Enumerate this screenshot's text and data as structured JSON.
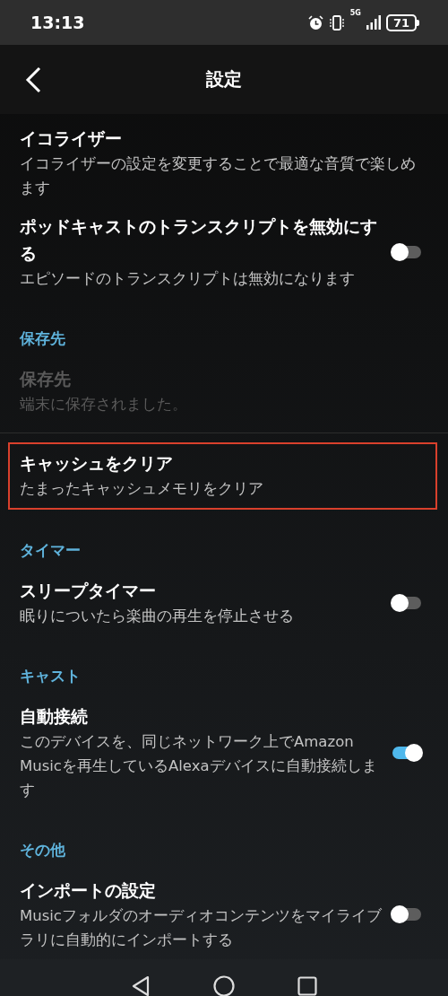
{
  "status_bar": {
    "time": "13:13",
    "network": "5G",
    "battery": "71"
  },
  "header": {
    "title": "設定"
  },
  "sections": [
    {
      "items": [
        {
          "kind": "plain",
          "title": "イコライザー",
          "subtitle": "イコライザーの設定を変更することで最適な音質で楽しめます",
          "disabled": false,
          "highlighted": false
        },
        {
          "kind": "toggle",
          "title": "ポッドキャストのトランスクリプトを無効にする",
          "subtitle": "エピソードのトランスクリプトは無効になります",
          "on": false,
          "disabled": false,
          "highlighted": false
        }
      ]
    },
    {
      "header": "保存先",
      "items": [
        {
          "kind": "plain",
          "title": "保存先",
          "subtitle": "端末に保存されました。",
          "disabled": true,
          "highlighted": false
        }
      ]
    },
    {
      "items": [
        {
          "kind": "plain",
          "title": "キャッシュをクリア",
          "subtitle": "たまったキャッシュメモリをクリア",
          "disabled": false,
          "highlighted": true
        }
      ]
    },
    {
      "header": "タイマー",
      "items": [
        {
          "kind": "toggle",
          "title": "スリープタイマー",
          "subtitle": "眠りについたら楽曲の再生を停止させる",
          "on": false,
          "disabled": false,
          "highlighted": false
        }
      ]
    },
    {
      "header": "キャスト",
      "items": [
        {
          "kind": "toggle",
          "title": "自動接続",
          "subtitle": "このデバイスを、同じネットワーク上でAmazon Musicを再生しているAlexaデバイスに自動接続します",
          "on": true,
          "disabled": false,
          "highlighted": false
        }
      ]
    },
    {
      "header": "その他",
      "items": [
        {
          "kind": "toggle",
          "title": "インポートの設定",
          "subtitle": "Musicフォルダのオーディオコンテンツをマイライブラリに自動的にインポートする",
          "on": false,
          "disabled": false,
          "highlighted": false
        }
      ]
    }
  ]
}
